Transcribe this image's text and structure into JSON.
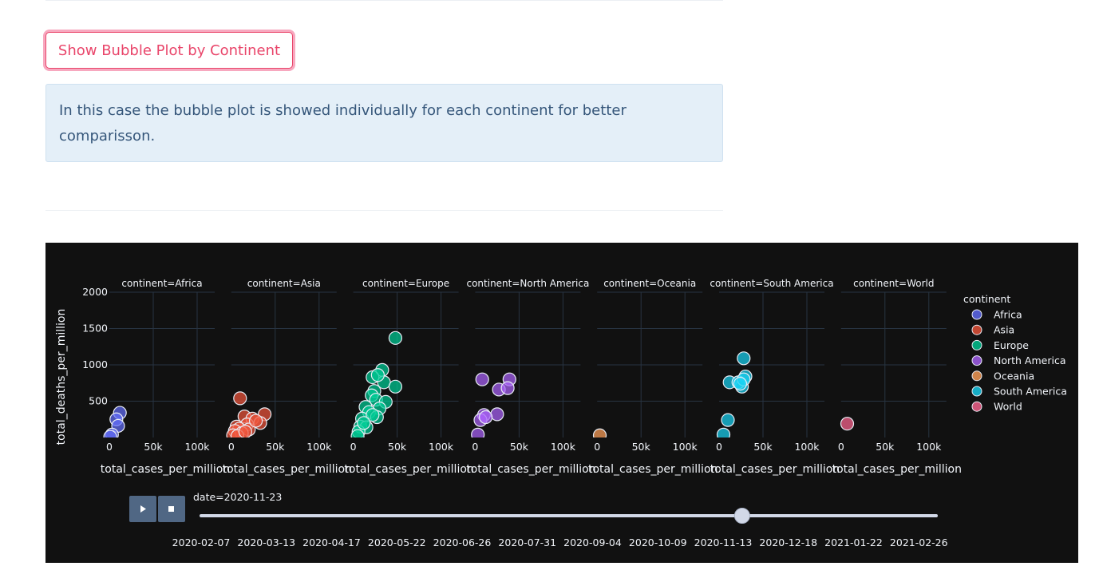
{
  "button": {
    "label": "Show Bubble Plot by Continent"
  },
  "info": {
    "text": "In this case the bubble plot is showed individually for each continent for better comparisson."
  },
  "slider": {
    "current_label": "date=2020-11-23",
    "current_value": "2020-11-23",
    "position_fraction": 0.735,
    "play_icon": "play-icon",
    "stop_icon": "stop-icon",
    "ticks": [
      "2020-02-07",
      "2020-03-13",
      "2020-04-17",
      "2020-05-22",
      "2020-06-26",
      "2020-07-31",
      "2020-09-04",
      "2020-10-09",
      "2020-11-13",
      "2020-12-18",
      "2021-01-22",
      "2021-02-26"
    ]
  },
  "chart_data": {
    "type": "scatter",
    "facet_prefix": "continent=",
    "xlabel": "total_cases_per_million",
    "ylabel": "total_deaths_per_million",
    "xlim": [
      0,
      120000
    ],
    "ylim": [
      0,
      2000
    ],
    "x_ticks": [
      0,
      50000,
      100000
    ],
    "x_tick_labels": [
      "0",
      "50k",
      "100k"
    ],
    "y_ticks": [
      500,
      1000,
      1500,
      2000
    ],
    "y_tick_labels": [
      "500",
      "1000",
      "1500",
      "2000"
    ],
    "legend_title": "continent",
    "legend_position": "right",
    "grid": true,
    "series": [
      {
        "name": "Africa",
        "color": "#636efa",
        "x": [
          12000,
          8000,
          10000,
          3000,
          1000
        ],
        "y": [
          340,
          250,
          160,
          40,
          10
        ]
      },
      {
        "name": "Asia",
        "color": "#ef553b",
        "x": [
          10000,
          38000,
          15000,
          24000,
          33000,
          18000,
          6000,
          9000,
          20000,
          4000,
          12000,
          28000,
          2000,
          7000,
          16000
        ],
        "y": [
          540,
          320,
          290,
          260,
          200,
          180,
          150,
          120,
          110,
          90,
          60,
          230,
          30,
          20,
          80
        ]
      },
      {
        "name": "Europe",
        "color": "#00cc96",
        "x": [
          48000,
          33000,
          22000,
          24000,
          35000,
          48000,
          21000,
          26000,
          37000,
          14000,
          30000,
          18000,
          27000,
          10000,
          8000,
          15000,
          22000,
          6000,
          12000,
          5000,
          28000
        ],
        "y": [
          1370,
          930,
          830,
          640,
          760,
          700,
          580,
          520,
          490,
          420,
          400,
          350,
          280,
          260,
          150,
          140,
          310,
          80,
          200,
          20,
          860
        ]
      },
      {
        "name": "North America",
        "color": "#ab63fa",
        "x": [
          8000,
          39000,
          27000,
          37000,
          10000,
          25000,
          6000,
          12000,
          3000
        ],
        "y": [
          800,
          800,
          660,
          680,
          310,
          320,
          240,
          280,
          40
        ]
      },
      {
        "name": "Oceania",
        "color": "#ffa15a",
        "x": [
          3000
        ],
        "y": [
          30
        ]
      },
      {
        "name": "South America",
        "color": "#19d3f3",
        "x": [
          28000,
          12000,
          30000,
          26000,
          22000,
          28000,
          24000,
          10000,
          5000
        ],
        "y": [
          1090,
          760,
          840,
          700,
          760,
          800,
          740,
          240,
          40
        ]
      },
      {
        "name": "World",
        "color": "#ff6692",
        "x": [
          7000
        ],
        "y": [
          190
        ]
      }
    ]
  }
}
